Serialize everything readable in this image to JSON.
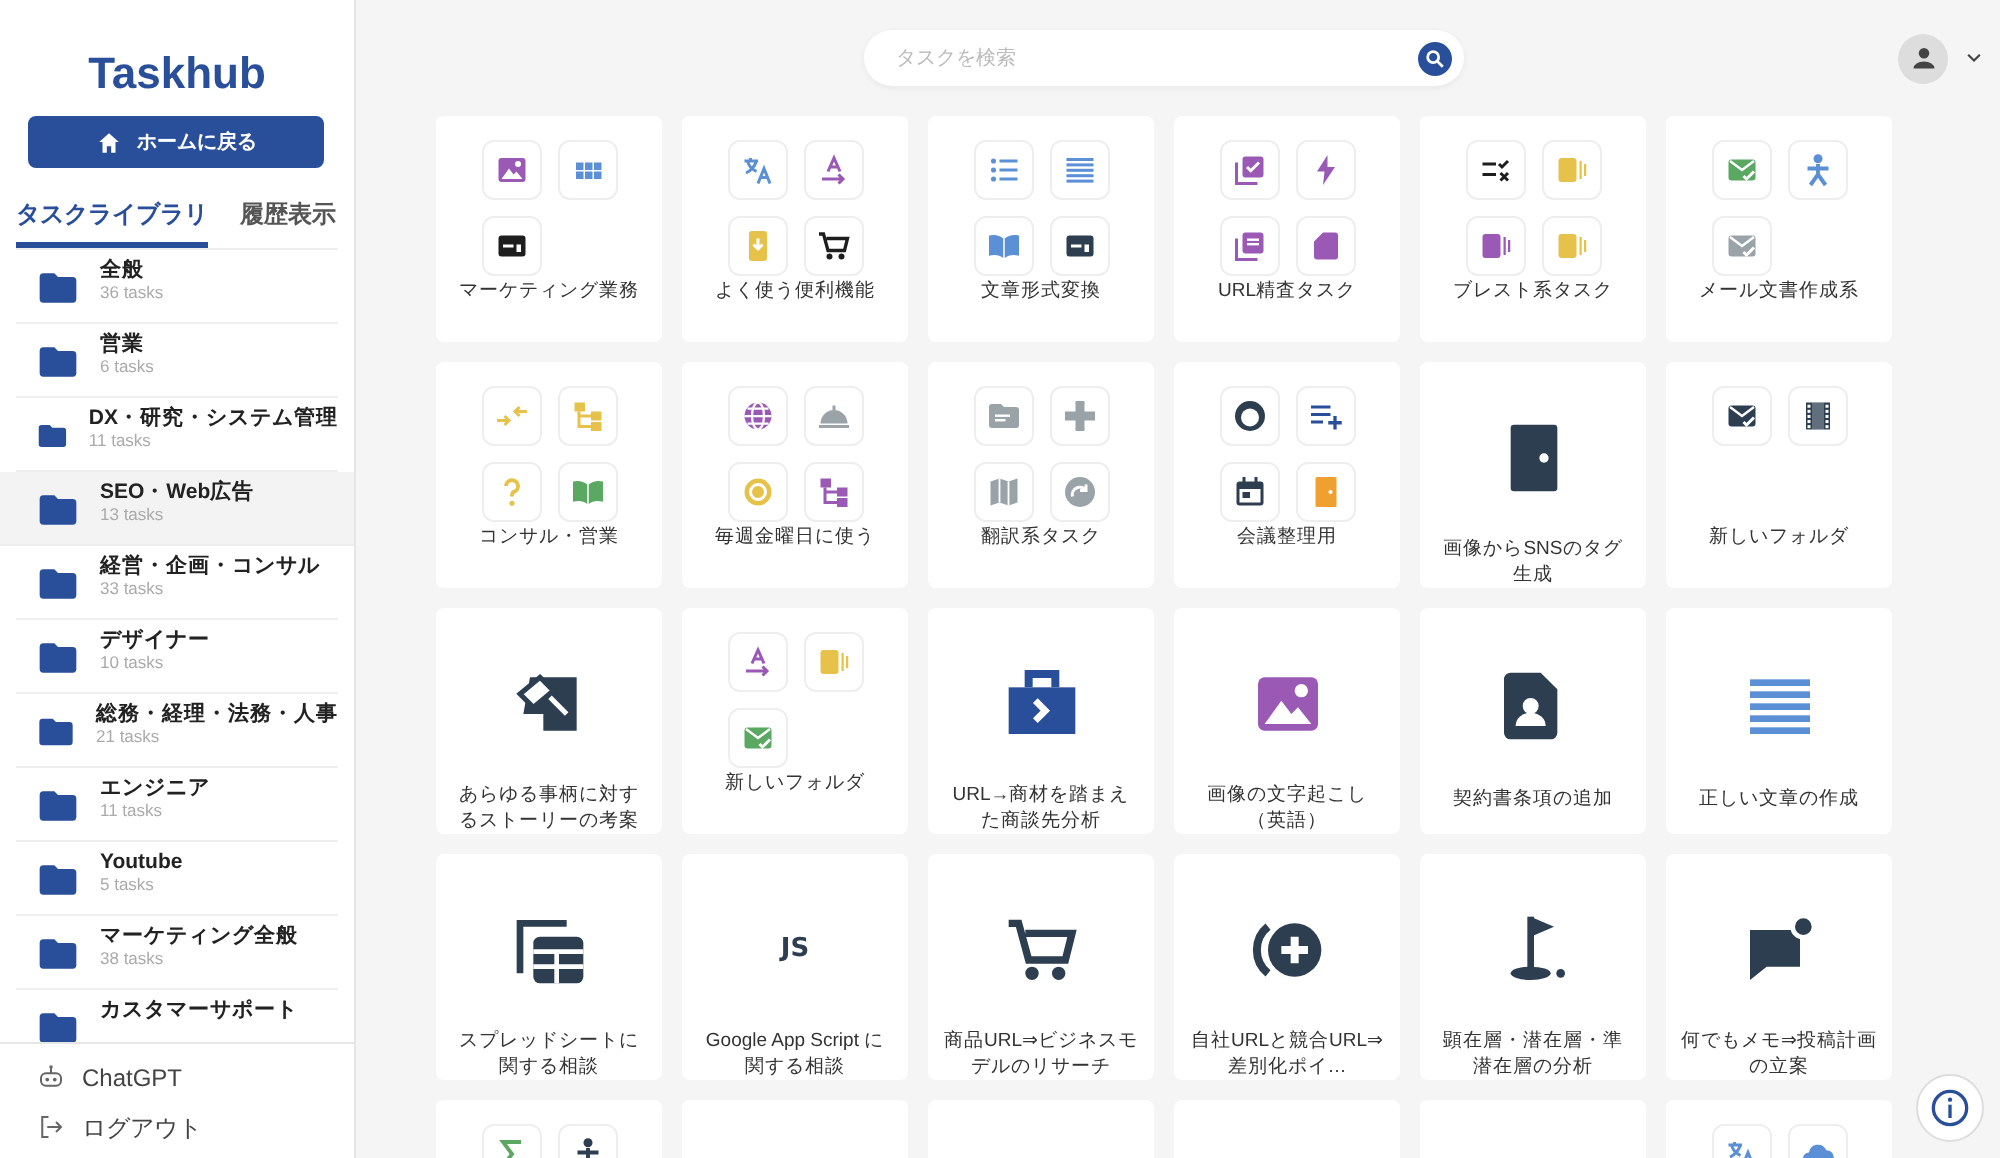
{
  "sidebar": {
    "logo": "Taskhub",
    "home_button": "ホームに戻る",
    "tabs": [
      {
        "label": "タスクライブラリ",
        "selected": true
      },
      {
        "label": "履歴表示",
        "selected": false
      }
    ],
    "folders": [
      {
        "name": "全般",
        "count": "36 tasks",
        "selected": false
      },
      {
        "name": "営業",
        "count": "6 tasks",
        "selected": false
      },
      {
        "name": "DX・研究・システム管理",
        "count": "11 tasks",
        "selected": false
      },
      {
        "name": "SEO・Web広告",
        "count": "13 tasks",
        "selected": true
      },
      {
        "name": "経営・企画・コンサル",
        "count": "33 tasks",
        "selected": false
      },
      {
        "name": "デザイナー",
        "count": "10 tasks",
        "selected": false
      },
      {
        "name": "総務・経理・法務・人事",
        "count": "21 tasks",
        "selected": false
      },
      {
        "name": "エンジニア",
        "count": "11 tasks",
        "selected": false
      },
      {
        "name": "Youtube",
        "count": "5 tasks",
        "selected": false
      },
      {
        "name": "マーケティング全般",
        "count": "38 tasks",
        "selected": false
      },
      {
        "name": "カスタマーサポート",
        "selected": false
      }
    ],
    "footer_links": [
      {
        "label": "ChatGPT"
      },
      {
        "label": "ログアウト"
      }
    ]
  },
  "search": {
    "placeholder": "タスクを検索"
  },
  "cards": [
    {
      "kind": "folder",
      "label": "マーケティング業務",
      "tiles": [
        {
          "color": "#9b59b6"
        },
        {
          "color": "#5b8fd6"
        },
        {
          "color": "#1e1e1e"
        }
      ]
    },
    {
      "kind": "folder",
      "label": "よく使う便利機能",
      "tiles": [
        {
          "color": "#5b8fd6"
        },
        {
          "color": "#9b59b6"
        },
        {
          "color": "#e6c24a"
        },
        {
          "color": "#1e1e1e"
        }
      ]
    },
    {
      "kind": "folder",
      "label": "文章形式変換",
      "tiles": [
        {
          "color": "#5b8fd6"
        },
        {
          "color": "#5b8fd6"
        },
        {
          "color": "#5b8fd6"
        },
        {
          "color": "#2c3e50"
        }
      ]
    },
    {
      "kind": "folder",
      "label": "URL精査タスク",
      "tiles": [
        {
          "color": "#9b59b6"
        },
        {
          "color": "#9b59b6"
        },
        {
          "color": "#9b59b6"
        },
        {
          "color": "#9b59b6"
        }
      ]
    },
    {
      "kind": "folder",
      "label": "ブレスト系タスク",
      "tiles": [
        {
          "color": "#1e1e1e"
        },
        {
          "color": "#e6c24a"
        },
        {
          "color": "#9b59b6"
        },
        {
          "color": "#e6c24a"
        }
      ]
    },
    {
      "kind": "folder",
      "label": "メール文書作成系",
      "tiles": [
        {
          "color": "#5aa862"
        },
        {
          "color": "#5b8fd6"
        },
        {
          "color": "#9aa3a8"
        }
      ]
    },
    {
      "kind": "folder",
      "label": "コンサル・営業",
      "tiles": [
        {
          "color": "#e6c24a"
        },
        {
          "color": "#e6c24a"
        },
        {
          "color": "#e6c24a"
        },
        {
          "color": "#5aa862"
        }
      ]
    },
    {
      "kind": "folder",
      "label": "毎週金曜日に使う",
      "tiles": [
        {
          "color": "#9b59b6"
        },
        {
          "color": "#9aa3a8"
        },
        {
          "color": "#e6c24a"
        },
        {
          "color": "#9b59b6"
        }
      ]
    },
    {
      "kind": "folder",
      "label": "翻訳系タスク",
      "tiles": [
        {
          "color": "#9aa3a8"
        },
        {
          "color": "#9aa3a8"
        },
        {
          "color": "#9aa3a8"
        },
        {
          "color": "#9aa3a8"
        }
      ]
    },
    {
      "kind": "folder",
      "label": "会議整理用",
      "tiles": [
        {
          "color": "#2c3e50"
        },
        {
          "color": "#2a4f9a"
        },
        {
          "color": "#2c3e50"
        },
        {
          "color": "#f0a030"
        }
      ]
    },
    {
      "kind": "task",
      "label": "画像からSNSのタグ生成",
      "color": "#2c3e50"
    },
    {
      "kind": "folder",
      "label": "新しいフォルダ",
      "tiles": [
        {
          "color": "#2c3e50"
        },
        {
          "color": "#2c3e50"
        }
      ]
    },
    {
      "kind": "task",
      "label": "あらゆる事柄に対するストーリーの考案",
      "color": "#2c3e50"
    },
    {
      "kind": "folder",
      "label": "新しいフォルダ",
      "tiles": [
        {
          "color": "#9b59b6"
        },
        {
          "color": "#e6c24a"
        },
        {
          "color": "#5aa862"
        }
      ]
    },
    {
      "kind": "task",
      "label": "URL→商材を踏まえた商談先分析",
      "color": "#2a4f9a"
    },
    {
      "kind": "task",
      "label": "画像の文字起こし（英語）",
      "color": "#9b59b6"
    },
    {
      "kind": "task",
      "label": "契約書条項の追加",
      "color": "#2c3e50"
    },
    {
      "kind": "task",
      "label": "正しい文章の作成",
      "color": "#5b8fd6"
    },
    {
      "kind": "task",
      "label": "スプレッドシートに関する相談",
      "color": "#2c3e50"
    },
    {
      "kind": "text",
      "label": "Google App Script に関する相談",
      "icon_text": "JS"
    },
    {
      "kind": "task",
      "label": "商品URL⇒ビジネスモデルのリサーチ",
      "color": "#2c3e50"
    },
    {
      "kind": "task",
      "label": "自社URLと競合URL⇒差別化ポイ…",
      "color": "#2c3e50"
    },
    {
      "kind": "task",
      "label": "顕在層・潜在層・準潜在層の分析",
      "color": "#2c3e50"
    },
    {
      "kind": "task",
      "label": "何でもメモ⇒投稿計画の立案",
      "color": "#2c3e50"
    },
    {
      "kind": "folder",
      "tiles": [
        {
          "color": "#5aa862"
        },
        {
          "color": "#2c3e50"
        }
      ]
    },
    {
      "kind": "blank"
    },
    {
      "kind": "blank"
    },
    {
      "kind": "blank"
    },
    {
      "kind": "blank"
    },
    {
      "kind": "folder",
      "tiles": [
        {
          "color": "#5b8fd6"
        },
        {
          "color": "#5b8fd6"
        }
      ]
    }
  ]
}
